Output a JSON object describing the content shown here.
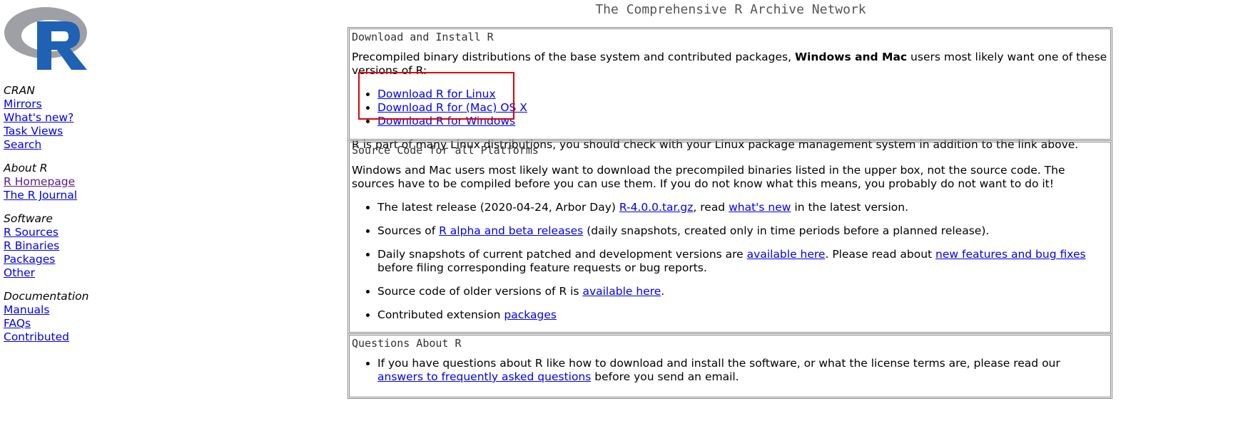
{
  "page_title": "The Comprehensive R Archive Network",
  "logo": {
    "icon": "r-logo-icon",
    "letter": "R",
    "color_ring": "#9ea0a6",
    "color_letter": "#1f62b3"
  },
  "sidebar": {
    "groups": [
      {
        "heading": "CRAN",
        "links": [
          "Mirrors",
          "What's new?",
          "Task Views",
          "Search"
        ]
      },
      {
        "heading": "About R",
        "links": [
          "R Homepage",
          "The R Journal"
        ]
      },
      {
        "heading": "Software",
        "links": [
          "R Sources",
          "R Binaries",
          "Packages",
          "Other"
        ]
      },
      {
        "heading": "Documentation",
        "links": [
          "Manuals",
          "FAQs",
          "Contributed"
        ]
      }
    ]
  },
  "download_box": {
    "heading": "Download and Install R",
    "intro_pre": "Precompiled binary distributions of the base system and contributed packages, ",
    "intro_bold": "Windows and Mac",
    "intro_post": " users most likely want one of these versions of R:",
    "links": [
      "Download R for Linux",
      "Download R for (Mac) OS X",
      "Download R for Windows"
    ],
    "footer": "R is part of many Linux distributions, you should check with your Linux package management system in addition to the link above."
  },
  "source_box": {
    "heading": "Source Code for all Platforms",
    "intro": "Windows and Mac users most likely want to download the precompiled binaries listed in the upper box, not the source code. The sources have to be compiled before you can use them. If you do not know what this means, you probably do not want to do it!",
    "item1_pre": "The latest release (2020-04-24, Arbor Day) ",
    "item1_link1": "R-4.0.0.tar.gz",
    "item1_mid": ", read ",
    "item1_link2": "what's new",
    "item1_post": " in the latest version.",
    "item2_pre": "Sources of ",
    "item2_link": "R alpha and beta releases",
    "item2_post": " (daily snapshots, created only in time periods before a planned release).",
    "item3_pre": "Daily snapshots of current patched and development versions are ",
    "item3_link1": "available here",
    "item3_mid": ". Please read about ",
    "item3_link2": "new features and bug fixes",
    "item3_post": " before filing corresponding feature requests or bug reports.",
    "item4_pre": "Source code of older versions of R is ",
    "item4_link": "available here",
    "item4_post": ".",
    "item5_pre": "Contributed extension ",
    "item5_link": "packages"
  },
  "questions_box": {
    "heading": "Questions About R",
    "item_pre": "If you have questions about R like how to download and install the software, or what the license terms are, please read our ",
    "item_link": "answers to frequently asked questions",
    "item_post": " before you send an email."
  },
  "colors": {
    "link": "#0000ee",
    "visited": "#551a8b",
    "highlight": "#e00000"
  }
}
